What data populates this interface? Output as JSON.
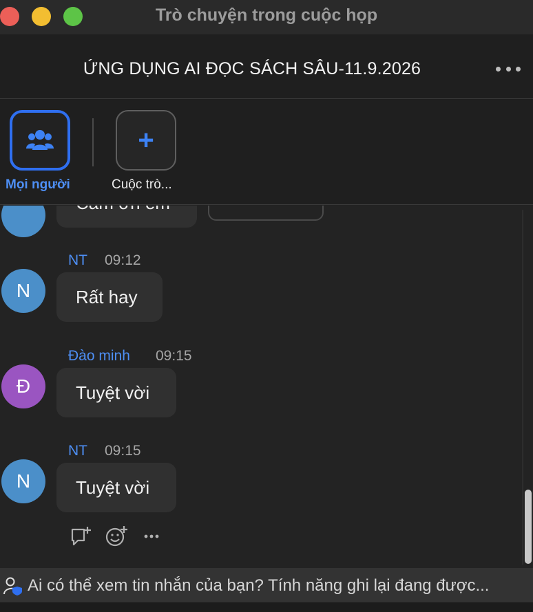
{
  "window": {
    "title": "Trò chuyện trong cuộc họp"
  },
  "header": {
    "meeting_title": "ỨNG DỤNG AI ĐỌC SÁCH SÂU-11.9.2026",
    "more_icon": "more-horizontal-icon"
  },
  "tabs": [
    {
      "label": "Mọi người",
      "icon": "people-icon",
      "selected": true
    },
    {
      "label": "Cuộc trò...",
      "icon": "plus-icon",
      "selected": false
    }
  ],
  "messages": [
    {
      "sender": "",
      "time": "",
      "text": "Cảm ơn em",
      "avatar_letter": "",
      "avatar_color": "#4b8fc9"
    },
    {
      "sender": "NT",
      "time": "09:12",
      "text": "Rất hay",
      "avatar_letter": "N",
      "avatar_color": "#4b8fc9"
    },
    {
      "sender": "Đào minh",
      "time": "09:15",
      "text": "Tuyệt vời",
      "avatar_letter": "Đ",
      "avatar_color": "#9a55c1"
    },
    {
      "sender": "NT",
      "time": "09:15",
      "text": "Tuyệt vời",
      "avatar_letter": "N",
      "avatar_color": "#4b8fc9"
    }
  ],
  "message_actions": [
    "reply-icon",
    "add-reaction-icon",
    "more-horizontal-icon"
  ],
  "privacy": {
    "text": "Ai có thể xem tin nhắn của bạn? Tính năng ghi lại đang được...",
    "icon": "person-shield-icon"
  },
  "colors": {
    "accent": "#2f6ff0",
    "sender_name": "#4e8ff5",
    "background": "#232323"
  }
}
